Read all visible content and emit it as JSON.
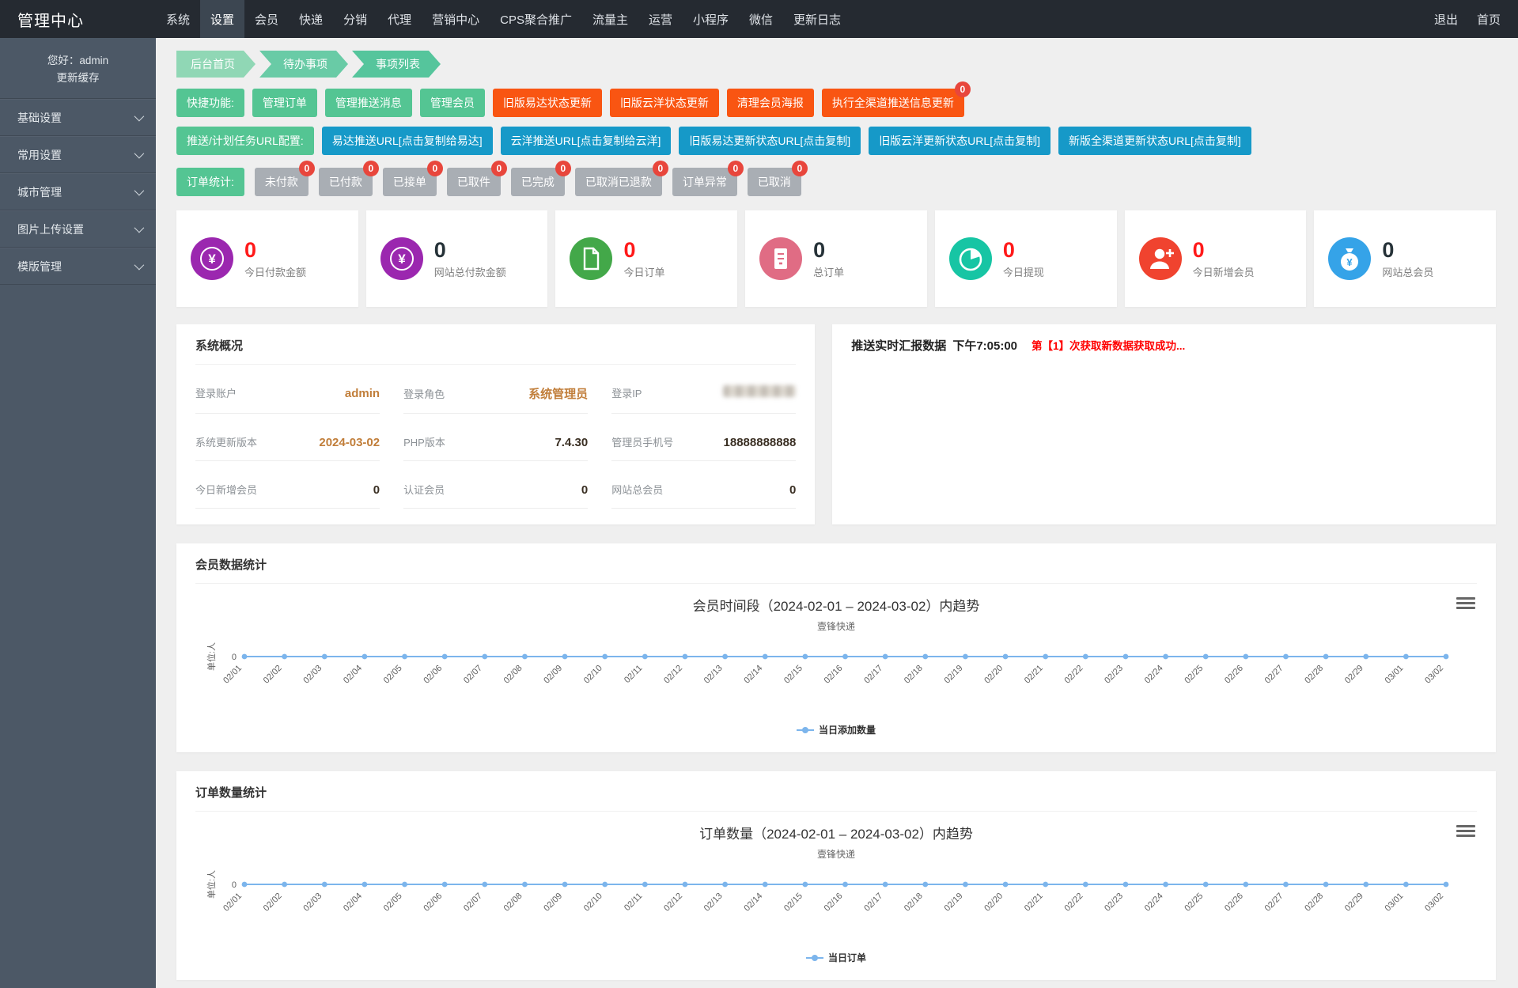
{
  "topbar": {
    "brand": "管理中心",
    "nav_items": [
      "系统",
      "设置",
      "会员",
      "快递",
      "分销",
      "代理",
      "营销中心",
      "CPS聚合推广",
      "流量主",
      "运营",
      "小程序",
      "微信",
      "更新日志"
    ],
    "active_item": "设置",
    "right_items": [
      "退出",
      "首页"
    ]
  },
  "sidebar": {
    "greeting": "您好：admin",
    "update_cache": "更新缓存",
    "menu_items": [
      "基础设置",
      "常用设置",
      "城市管理",
      "图片上传设置",
      "模版管理"
    ]
  },
  "breadcrumb": [
    "后台首页",
    "待办事项",
    "事项列表"
  ],
  "toolbar": {
    "rows": [
      {
        "label": "快捷功能:",
        "buttons": [
          {
            "text": "管理订单",
            "color": "green"
          },
          {
            "text": "管理推送消息",
            "color": "green"
          },
          {
            "text": "管理会员",
            "color": "green"
          },
          {
            "text": "旧版易达状态更新",
            "color": "orange"
          },
          {
            "text": "旧版云洋状态更新",
            "color": "orange"
          },
          {
            "text": "清理会员海报",
            "color": "orange"
          },
          {
            "text": "执行全渠道推送信息更新",
            "color": "orange",
            "badge": "0"
          }
        ]
      },
      {
        "label": "推送/计划任务URL配置:",
        "buttons": [
          {
            "text": "易达推送URL[点击复制给易达]",
            "color": "blue"
          },
          {
            "text": "云洋推送URL[点击复制给云洋]",
            "color": "blue"
          },
          {
            "text": "旧版易达更新状态URL[点击复制]",
            "color": "blue"
          },
          {
            "text": "旧版云洋更新状态URL[点击复制]",
            "color": "blue"
          },
          {
            "text": "新版全渠道更新状态URL[点击复制]",
            "color": "blue"
          }
        ]
      },
      {
        "label": "订单统计:",
        "buttons": [
          {
            "text": "未付款",
            "color": "gray",
            "badge": "0"
          },
          {
            "text": "已付款",
            "color": "gray",
            "badge": "0"
          },
          {
            "text": "已接单",
            "color": "gray",
            "badge": "0"
          },
          {
            "text": "已取件",
            "color": "gray",
            "badge": "0"
          },
          {
            "text": "已完成",
            "color": "gray",
            "badge": "0"
          },
          {
            "text": "已取消已退款",
            "color": "gray",
            "badge": "0"
          },
          {
            "text": "订单异常",
            "color": "gray",
            "badge": "0"
          },
          {
            "text": "已取消",
            "color": "gray",
            "badge": "0"
          }
        ]
      }
    ]
  },
  "stat_cards": [
    {
      "value": "0",
      "label": "今日付款金额",
      "icon": "yen-icon",
      "icon_color": "#9b27af",
      "value_color": "#ff1a1a"
    },
    {
      "value": "0",
      "label": "网站总付款金额",
      "icon": "yen-icon",
      "icon_color": "#9b27af",
      "value_color": "#263238"
    },
    {
      "value": "0",
      "label": "今日订单",
      "icon": "document-icon",
      "icon_color": "#43a849",
      "value_color": "#ff1a1a"
    },
    {
      "value": "0",
      "label": "总订单",
      "icon": "list-icon",
      "icon_color": "#e06c84",
      "value_color": "#263238"
    },
    {
      "value": "0",
      "label": "今日提现",
      "icon": "pie-icon",
      "icon_color": "#17c5a4",
      "value_color": "#ff1a1a"
    },
    {
      "value": "0",
      "label": "今日新增会员",
      "icon": "user-plus-icon",
      "icon_color": "#f0432f",
      "value_color": "#ff1a1a"
    },
    {
      "value": "0",
      "label": "网站总会员",
      "icon": "moneybag-icon",
      "icon_color": "#35a3e8",
      "value_color": "#263238"
    }
  ],
  "system_overview": {
    "title": "系统概况",
    "rows": [
      [
        {
          "label": "登录账户",
          "value": "admin",
          "style": "orange"
        },
        {
          "label": "登录角色",
          "value": "系统管理员",
          "style": "orange"
        },
        {
          "label": "登录IP",
          "value": "",
          "style": "blurred"
        }
      ],
      [
        {
          "label": "系统更新版本",
          "value": "2024-03-02",
          "style": "orange"
        },
        {
          "label": "PHP版本",
          "value": "7.4.30",
          "style": "dark"
        },
        {
          "label": "管理员手机号",
          "value": "18888888888",
          "style": "dark"
        }
      ],
      [
        {
          "label": "今日新增会员",
          "value": "0",
          "style": "dark"
        },
        {
          "label": "认证会员",
          "value": "0",
          "style": "dark"
        },
        {
          "label": "网站总会员",
          "value": "0",
          "style": "dark"
        }
      ]
    ]
  },
  "push_panel": {
    "title": "推送实时汇报数据",
    "time": "下午7:05:00",
    "message": "第【1】次获取新数据获取成功..."
  },
  "member_panel_title": "会员数据统计",
  "order_panel_title": "订单数量统计",
  "chart_data": [
    {
      "type": "line",
      "title": "会员时间段（2024-02-01 – 2024-03-02）内趋势",
      "subtitle": "壹锋快递",
      "ylabel": "单位:人",
      "x": [
        "02/01",
        "02/02",
        "02/03",
        "02/04",
        "02/05",
        "02/06",
        "02/07",
        "02/08",
        "02/09",
        "02/10",
        "02/11",
        "02/12",
        "02/13",
        "02/14",
        "02/15",
        "02/16",
        "02/17",
        "02/18",
        "02/19",
        "02/20",
        "02/21",
        "02/22",
        "02/23",
        "02/24",
        "02/25",
        "02/26",
        "02/27",
        "02/28",
        "02/29",
        "03/01",
        "03/02"
      ],
      "series": [
        {
          "name": "当日添加数量",
          "color": "#7cb5ec",
          "values": [
            0,
            0,
            0,
            0,
            0,
            0,
            0,
            0,
            0,
            0,
            0,
            0,
            0,
            0,
            0,
            0,
            0,
            0,
            0,
            0,
            0,
            0,
            0,
            0,
            0,
            0,
            0,
            0,
            0,
            0,
            0
          ]
        }
      ],
      "ylim": [
        0,
        1
      ],
      "grid": false,
      "legend_position": "bottom",
      "yticks": [
        "0"
      ]
    },
    {
      "type": "line",
      "title": "订单数量（2024-02-01 – 2024-03-02）内趋势",
      "subtitle": "壹锋快递",
      "ylabel": "单位:人",
      "x": [
        "02/01",
        "02/02",
        "02/03",
        "02/04",
        "02/05",
        "02/06",
        "02/07",
        "02/08",
        "02/09",
        "02/10",
        "02/11",
        "02/12",
        "02/13",
        "02/14",
        "02/15",
        "02/16",
        "02/17",
        "02/18",
        "02/19",
        "02/20",
        "02/21",
        "02/22",
        "02/23",
        "02/24",
        "02/25",
        "02/26",
        "02/27",
        "02/28",
        "02/29",
        "03/01",
        "03/02"
      ],
      "series": [
        {
          "name": "当日订单",
          "color": "#7cb5ec",
          "values": [
            0,
            0,
            0,
            0,
            0,
            0,
            0,
            0,
            0,
            0,
            0,
            0,
            0,
            0,
            0,
            0,
            0,
            0,
            0,
            0,
            0,
            0,
            0,
            0,
            0,
            0,
            0,
            0,
            0,
            0,
            0
          ]
        }
      ],
      "ylim": [
        0,
        1
      ],
      "grid": false,
      "legend_position": "bottom",
      "yticks": [
        "0"
      ]
    }
  ]
}
